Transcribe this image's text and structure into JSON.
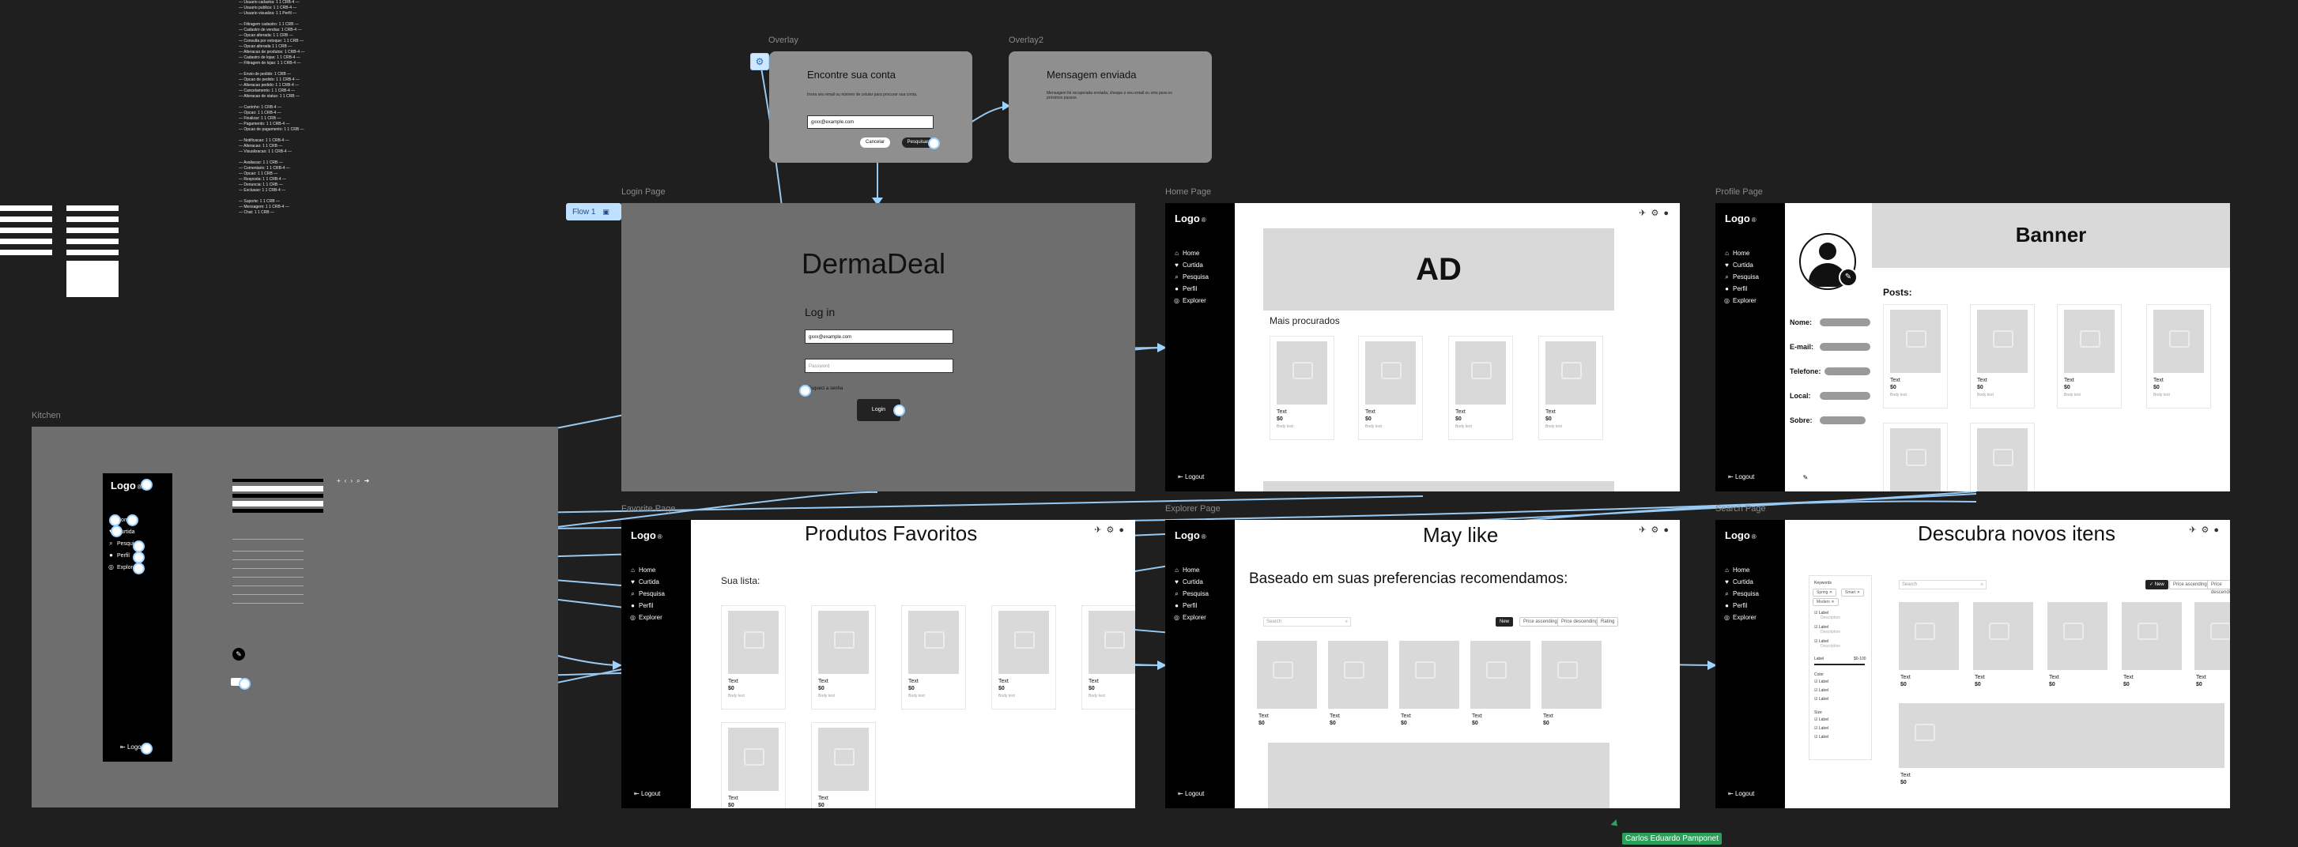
{
  "frames": {
    "overlay": {
      "label": "Overlay",
      "title": "Encontre sua conta",
      "desc": "Insira seu email ou número de celular para procurar sua conta.",
      "input": "gxxx@example.com",
      "cancel": "Cancelar",
      "search": "Pesquisar"
    },
    "overlay2": {
      "label": "Overlay2",
      "title": "Mensagem enviada",
      "desc": "Mensagem foi recuperada enviada, cheque o seu email ou sms para os próximos passos."
    },
    "login": {
      "label": "Login Page",
      "brand": "DermaDeal",
      "heading": "Log in",
      "email": "gxxx@example.com",
      "password": "Password",
      "forgot": "Esqueci a senha",
      "button": "Login"
    },
    "home": {
      "label": "Home Page",
      "ad": "AD",
      "section": "Mais procurados"
    },
    "profile": {
      "label": "Profile Page",
      "banner": "Banner",
      "posts": "Posts:",
      "fields": [
        "Nome:",
        "E-mail:",
        "Telefone:",
        "Local:",
        "Sobre:"
      ],
      "edit": "Editar"
    },
    "favorite": {
      "label": "Favorite Page",
      "title": "Produtos Favoritos",
      "list": "Sua lista:"
    },
    "may": {
      "label": "Explorer Page",
      "title": "May like",
      "subtitle": "Baseado em suas preferencias recomendamos:",
      "search": "Search",
      "filters": [
        "New",
        "Price ascending",
        "Price descending",
        "Rating"
      ]
    },
    "search": {
      "label": "Search Page",
      "title": "Descubra novos itens",
      "search": "Search",
      "filters": [
        "New",
        "Price ascending",
        "Price descending"
      ],
      "keywords": "Keywords",
      "tags": [
        "Spring",
        "Smart",
        "Modern"
      ],
      "label_text": "Label",
      "desc_text": "Description",
      "range": "$0-100",
      "color": "Color",
      "size": "Size"
    },
    "kitchen": {
      "label": "Kitchen"
    }
  },
  "sidebar": {
    "logo": "Logo",
    "reg": "®",
    "items": [
      "Home",
      "Curtida",
      "Pesquisa",
      "Perfil",
      "Explorer"
    ],
    "logout": "Logout"
  },
  "card": {
    "title": "Text",
    "price": "$0",
    "sub": "Body text"
  },
  "flow": {
    "label": "Flow 1"
  },
  "cursor": {
    "user": "Carlos Eduardo Pamponet"
  },
  "colors": {
    "canvas": "#1f1f1f",
    "connector": "#9fd3ff",
    "cursor": "#2e9e5b"
  }
}
